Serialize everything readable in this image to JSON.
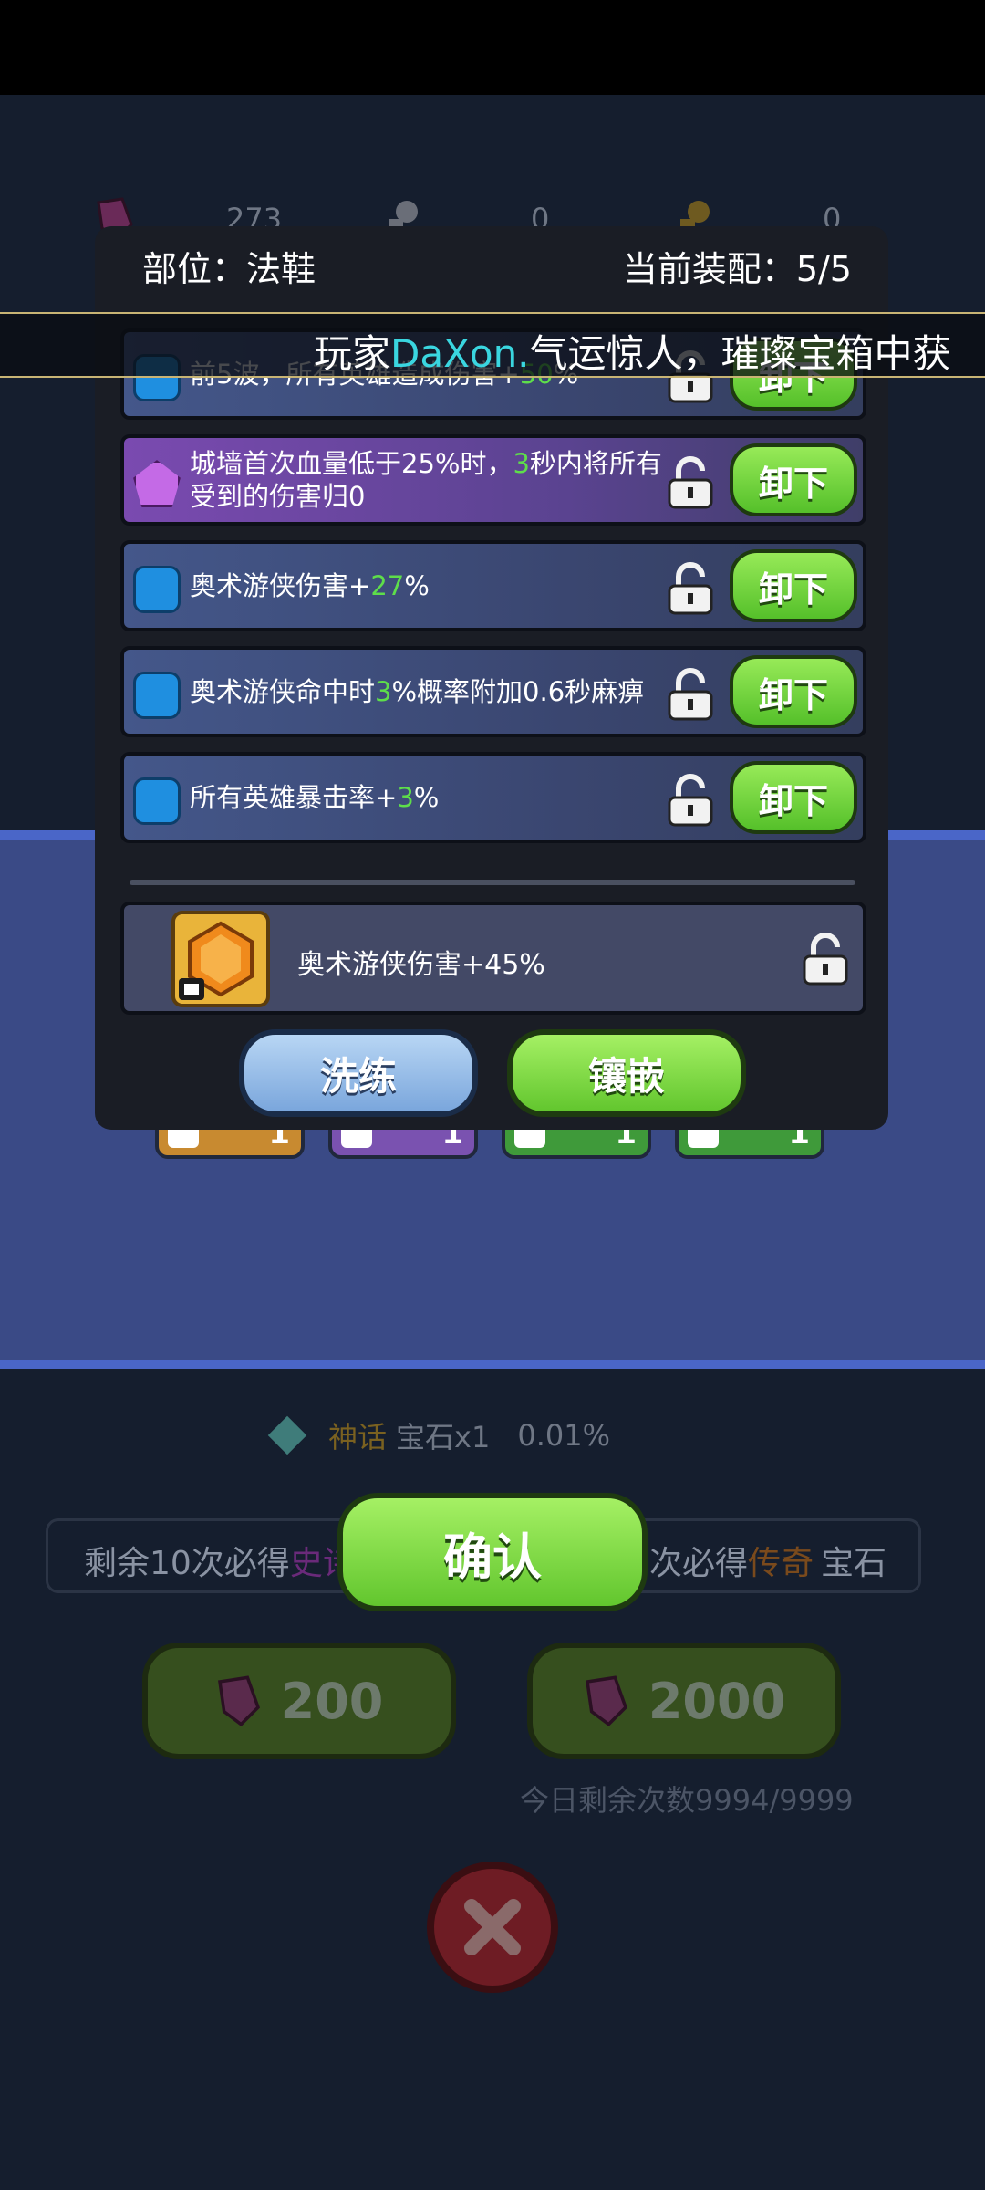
{
  "currencies": [
    {
      "icon": "purple-gem-icon",
      "value": "273"
    },
    {
      "icon": "silver-key-icon",
      "value": "0"
    },
    {
      "icon": "gold-key-icon",
      "value": "0"
    }
  ],
  "dialog": {
    "position_label": "部位：法鞋",
    "equipped_label": "当前装配：5/5",
    "slots": [
      {
        "text_a": "前5波，所有英雄造成伤害+",
        "text_b": "50",
        "text_c": "%",
        "button": "卸下",
        "style": "blue"
      },
      {
        "text_a": "城墙首次血量低于25%时，",
        "text_b": "3",
        "text_c": "秒内将所有受到的伤害归0",
        "button": "卸下",
        "style": "purple"
      },
      {
        "text_a": "奥术游侠伤害+",
        "text_b": "27",
        "text_c": "%",
        "button": "卸下",
        "style": "blue"
      },
      {
        "text_a": "奥术游侠命中时",
        "text_b": "3",
        "text_c": "%概率附加0.6秒麻痹",
        "button": "卸下",
        "style": "blue"
      },
      {
        "text_a": "所有英雄暴击率+",
        "text_b": "3",
        "text_c": "%",
        "button": "卸下",
        "style": "blue"
      }
    ],
    "new_gem_text": "奥术游侠伤害+45%",
    "reforge_button": "洗练",
    "inlay_button": "镶嵌"
  },
  "announcement": {
    "prefix": "玩家",
    "player": "DaXon.",
    "suffix": "气运惊人，璀璨宝箱中获"
  },
  "background": {
    "chip_counts": [
      "1",
      "1",
      "1",
      "1"
    ],
    "rate_rarity": "神话",
    "rate_item": "宝石x1",
    "rate_value": "0.01%",
    "pity_left_a": "剩余10次必得",
    "pity_left_b": "史诗",
    "pity_right_a": "次必得",
    "pity_right_b": "传奇",
    "pity_right_c": "宝石",
    "draw_one_cost": "200",
    "draw_ten_cost": "2000",
    "remaining_today": "今日剩余次数9994/9999"
  },
  "confirm_button": "确认",
  "colors": {
    "green_value": "#5ede4a",
    "player_name": "#3ad6e0",
    "epic": "#b64ce0",
    "legendary": "#e08a2c",
    "mythic": "#e3b23a"
  }
}
